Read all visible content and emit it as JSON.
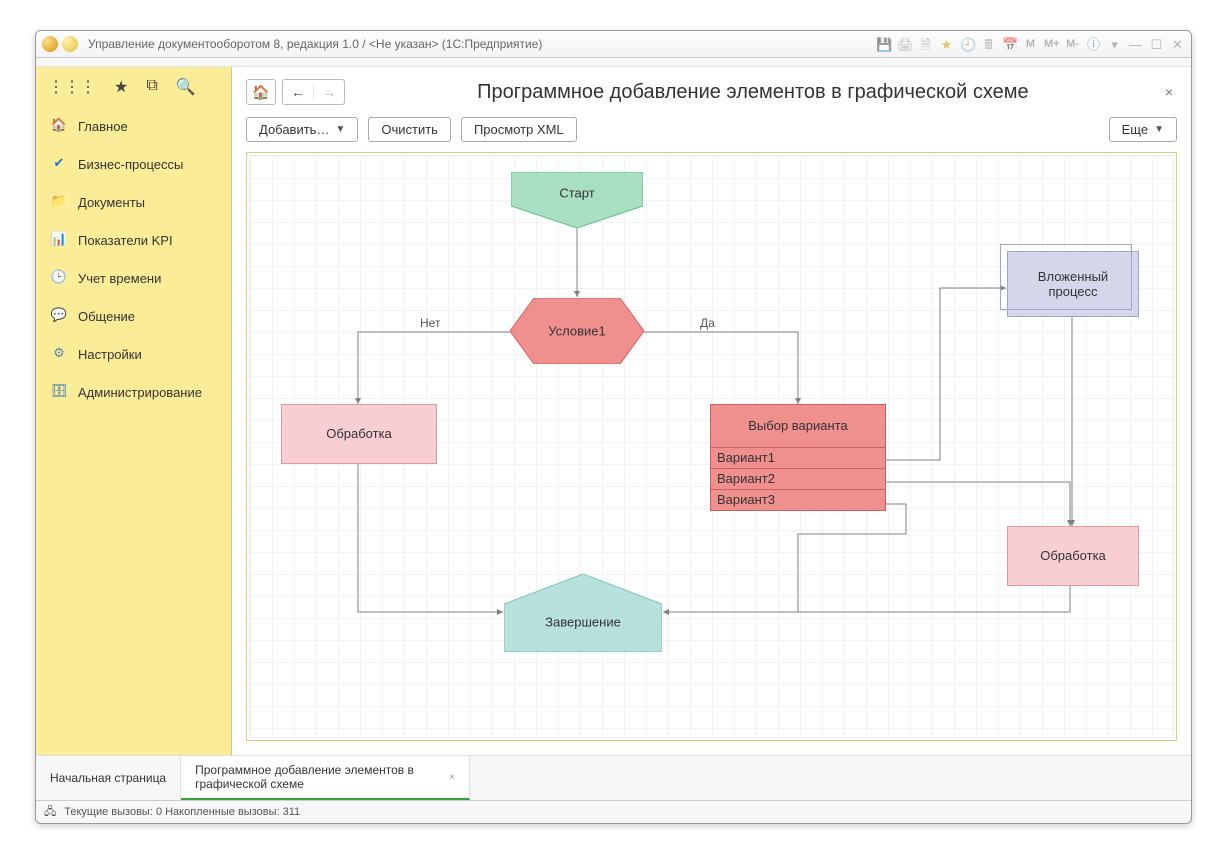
{
  "window": {
    "title": "Управление документооборотом 8, редакция 1.0 / <Не указан>  (1С:Предприятие)"
  },
  "sidebar": {
    "items": [
      {
        "label": "Главное"
      },
      {
        "label": "Бизнес-процессы"
      },
      {
        "label": "Документы"
      },
      {
        "label": "Показатели KPI"
      },
      {
        "label": "Учет времени"
      },
      {
        "label": "Общение"
      },
      {
        "label": "Настройки"
      },
      {
        "label": "Администрирование"
      }
    ]
  },
  "page": {
    "title": "Программное добавление элементов в графической схеме",
    "toolbar": {
      "add": "Добавить…",
      "clear": "Очистить",
      "xml": "Просмотр XML",
      "more": "Еще"
    }
  },
  "diagram": {
    "nodes": {
      "start": "Старт",
      "condition": "Условие1",
      "process_left": "Обработка",
      "choice": "Выбор варианта",
      "variants": [
        "Вариант1",
        "Вариант2",
        "Вариант3"
      ],
      "subprocess": "Вложенный\nпроцесс",
      "process_right": "Обработка",
      "end": "Завершение"
    },
    "edges": {
      "no": "Нет",
      "yes": "Да"
    }
  },
  "tabs": {
    "start": "Начальная страница",
    "current": "Программное добавление элементов в графической схеме"
  },
  "status": {
    "text": "Текущие вызовы: 0   Накопленные вызовы: 311"
  }
}
